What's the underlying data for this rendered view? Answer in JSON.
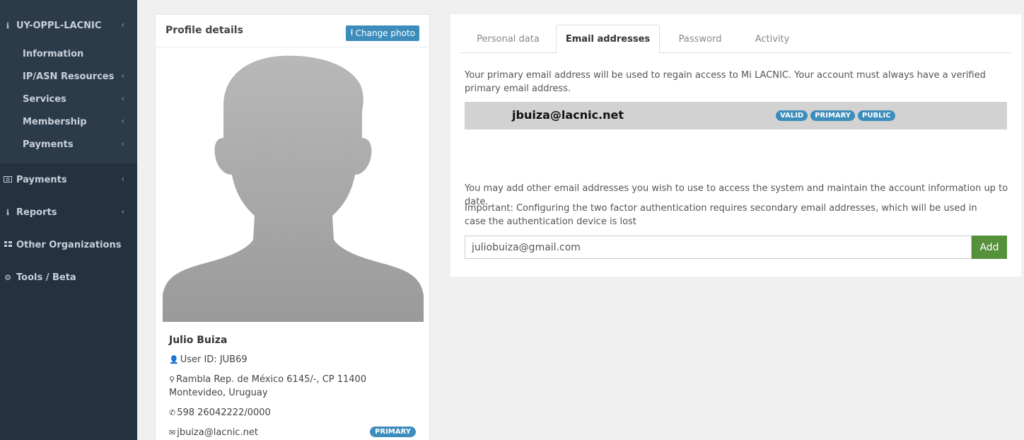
{
  "sidebar": {
    "org": {
      "label": "UY-OPPL-LACNIC",
      "icon": "info-icon"
    },
    "org_items": [
      {
        "label": "Information"
      },
      {
        "label": "IP/ASN Resources"
      },
      {
        "label": "Services"
      },
      {
        "label": "Membership"
      },
      {
        "label": "Payments"
      }
    ],
    "items": [
      {
        "label": "Payments",
        "icon": "money-icon"
      },
      {
        "label": "Reports",
        "icon": "info-icon"
      },
      {
        "label": "Other Organizations",
        "icon": "grid-icon"
      },
      {
        "label": "Tools / Beta",
        "icon": "gears-icon"
      }
    ]
  },
  "profile": {
    "title": "Profile details",
    "change_photo": "Change photo",
    "name": "Julio Buiza",
    "user_id": "User ID: JUB69",
    "address": "Rambla Rep. de México 6145/-, CP 11400 Montevideo, Uruguay",
    "phone": "598 26042222/0000",
    "email": "jbuiza@lacnic.net",
    "email_badge": "PRIMARY"
  },
  "tabs": [
    "Personal data",
    "Email addresses",
    "Password",
    "Activity"
  ],
  "active_tab": "Email addresses",
  "emails": {
    "intro": "Your primary email address will be used to regain access to Mi LACNIC. Your account must always have a verified primary email address.",
    "primary": {
      "address": "jbuiza@lacnic.net",
      "badges": [
        "VALID",
        "PRIMARY",
        "PUBLIC"
      ]
    },
    "add_info": "You may add other email addresses you wish to use to access the system and maintain the account information up to date.",
    "important": "Important: Configuring the two factor authentication requires secondary email addresses, which will be used in case the authentication device is lost",
    "add_input_value": "juliobuiza@gmail.com",
    "add_button": "Add"
  },
  "colors": {
    "sidebar_bg": "#243140",
    "accent": "#3c8dbc",
    "add_button": "#55903a"
  }
}
